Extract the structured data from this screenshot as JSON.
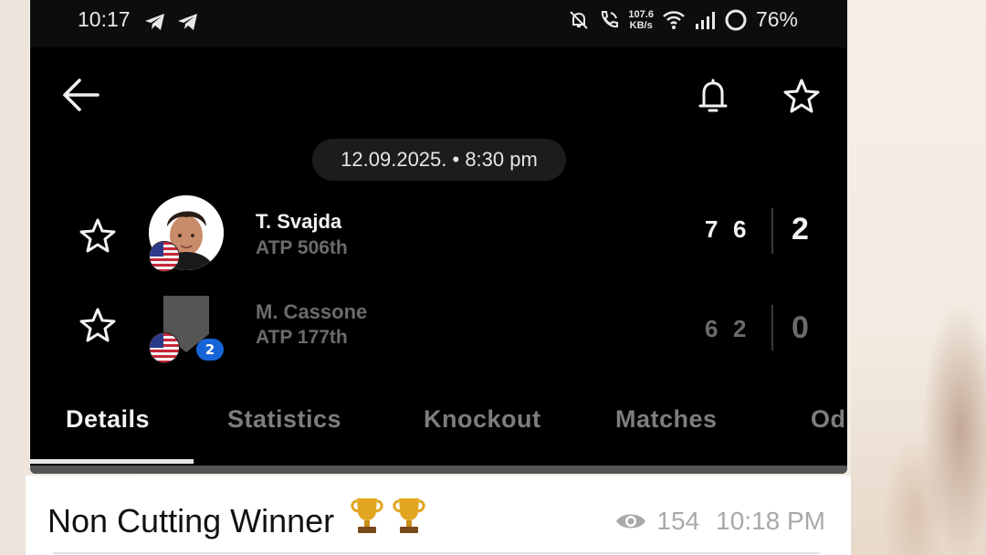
{
  "status_bar": {
    "time": "10:17",
    "speed_value": "107.6",
    "speed_unit": "KB/s",
    "battery": "76%"
  },
  "header": {
    "back_icon": "arrow-left-icon",
    "bell_icon": "bell-icon",
    "star_icon": "star-outline-icon"
  },
  "match": {
    "datetime": "12.09.2025. • 8:30 pm",
    "players": [
      {
        "name": "T. Svajda",
        "rank": "ATP 506th",
        "set1": "7",
        "set2": "6",
        "sets_won": "2",
        "flag": "usa-flag",
        "winner": true
      },
      {
        "name": "M. Cassone",
        "rank": "ATP 177th",
        "set1": "6",
        "set2": "2",
        "sets_won": "0",
        "flag": "usa-flag",
        "seed": "2",
        "winner": false
      }
    ]
  },
  "tabs": [
    {
      "label": "Details",
      "active": true
    },
    {
      "label": "Statistics",
      "active": false
    },
    {
      "label": "Knockout",
      "active": false
    },
    {
      "label": "Matches",
      "active": false
    },
    {
      "label": "Od",
      "active": false
    }
  ],
  "message": {
    "text": "Non Cutting Winner",
    "emoji": "🏆🏆",
    "views": "154",
    "time": "10:18 PM"
  },
  "colors": {
    "app_background": "#000000",
    "active_text": "#f2f2f2",
    "inactive_text": "#7d7d7d",
    "seed_badge": "#1565d8"
  }
}
